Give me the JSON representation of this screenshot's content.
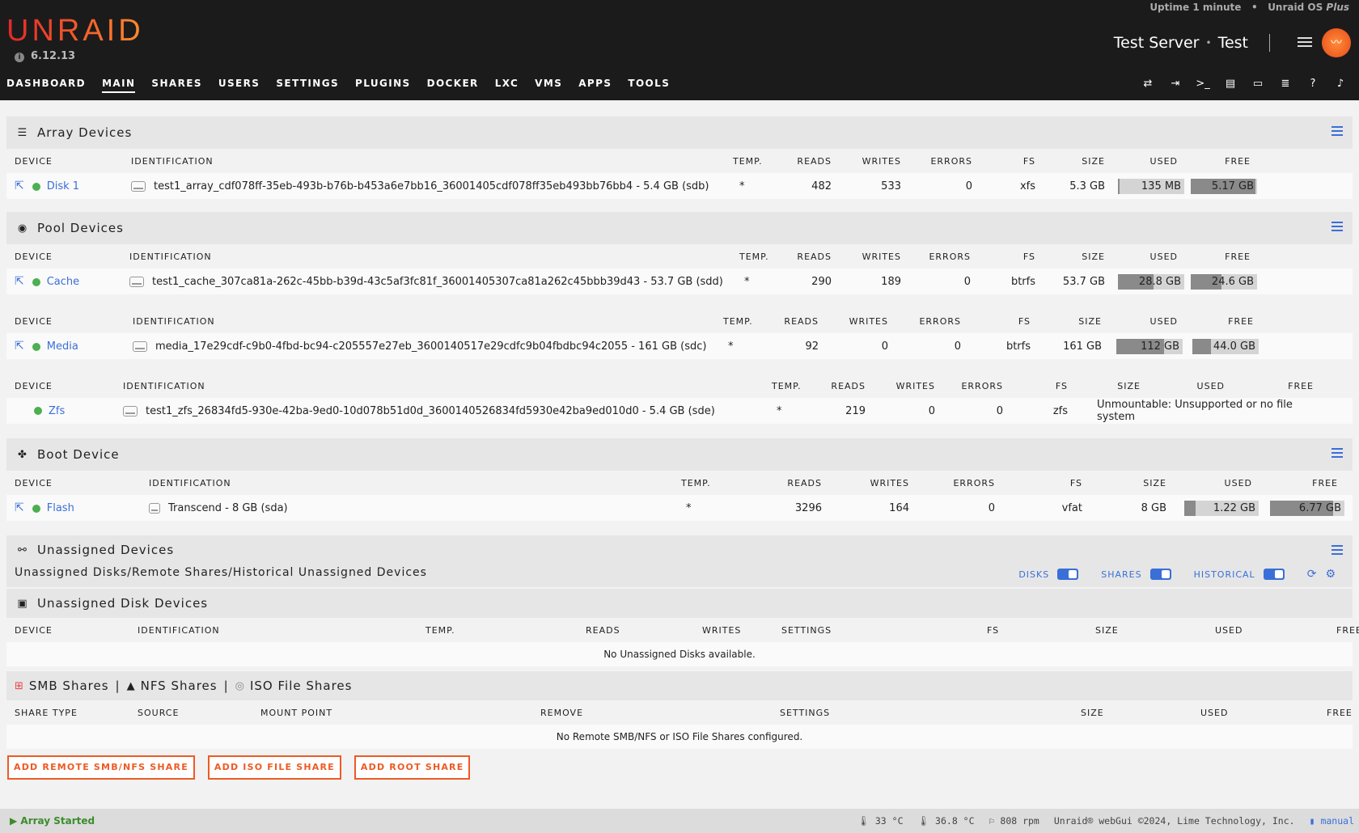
{
  "header": {
    "logo": "UNRAID",
    "version": "6.12.13",
    "uptime": "Uptime 1 minute",
    "bullet": "•",
    "os_name": "Unraid OS",
    "os_edition": "Plus",
    "server_name": "Test Server",
    "server_desc": "Test"
  },
  "nav": [
    "DASHBOARD",
    "MAIN",
    "SHARES",
    "USERS",
    "SETTINGS",
    "PLUGINS",
    "DOCKER",
    "LXC",
    "VMS",
    "APPS",
    "TOOLS"
  ],
  "nav_active": "MAIN",
  "nav_icons": [
    "sync-icon",
    "logout-icon",
    "terminal-icon",
    "feedback-icon",
    "display-icon",
    "log-icon",
    "help-icon",
    "bell-icon"
  ],
  "array": {
    "title": "Array Devices",
    "headers": [
      "DEVICE",
      "IDENTIFICATION",
      "TEMP.",
      "READS",
      "WRITES",
      "ERRORS",
      "FS",
      "SIZE",
      "USED",
      "FREE"
    ],
    "rows": [
      {
        "device": "Disk 1",
        "id": "test1_array_cdf078ff-35eb-493b-b76b-b453a6e7bb16_36001405cdf078ff35eb493bb76bb4 - 5.4 GB (sdb)",
        "temp": "*",
        "reads": "482",
        "writes": "533",
        "errors": "0",
        "fs": "xfs",
        "size": "5.3 GB",
        "used": "135 MB",
        "free": "5.17 GB",
        "used_frac": 0.03,
        "free_frac": 0.97
      }
    ]
  },
  "pool": {
    "title": "Pool Devices",
    "headers": [
      "DEVICE",
      "IDENTIFICATION",
      "TEMP.",
      "READS",
      "WRITES",
      "ERRORS",
      "FS",
      "SIZE",
      "USED",
      "FREE"
    ],
    "pools": [
      {
        "device": "Cache",
        "id": "test1_cache_307ca81a-262c-45bb-b39d-43c5af3fc81f_36001405307ca81a262c45bbb39d43 - 53.7 GB (sdd)",
        "temp": "*",
        "reads": "290",
        "writes": "189",
        "errors": "0",
        "fs": "btrfs",
        "size": "53.7 GB",
        "used": "28.8 GB",
        "free": "24.6 GB",
        "used_frac": 0.54,
        "free_frac": 0.46
      },
      {
        "device": "Media",
        "id": "media_17e29cdf-c9b0-4fbd-bc94-c205557e27eb_3600140517e29cdfc9b04fbdbc94c2055 - 161 GB (sdc)",
        "temp": "*",
        "reads": "92",
        "writes": "0",
        "errors": "0",
        "fs": "btrfs",
        "size": "161 GB",
        "used": "112 GB",
        "free": "44.0 GB",
        "used_frac": 0.72,
        "free_frac": 0.28
      },
      {
        "device": "Zfs",
        "id": "test1_zfs_26834fd5-930e-42ba-9ed0-10d078b51d0d_3600140526834fd5930e42ba9ed010d0 - 5.4 GB (sde)",
        "temp": "*",
        "reads": "219",
        "writes": "0",
        "errors": "0",
        "fs": "zfs",
        "status": "Unmountable: Unsupported or no file system"
      }
    ]
  },
  "boot": {
    "title": "Boot Device",
    "headers": [
      "DEVICE",
      "IDENTIFICATION",
      "TEMP.",
      "READS",
      "WRITES",
      "ERRORS",
      "FS",
      "SIZE",
      "USED",
      "FREE"
    ],
    "row": {
      "device": "Flash",
      "id": "Transcend - 8 GB (sda)",
      "temp": "*",
      "reads": "3296",
      "writes": "164",
      "errors": "0",
      "fs": "vfat",
      "size": "8 GB",
      "used": "1.22 GB",
      "free": "6.77 GB",
      "used_frac": 0.15,
      "free_frac": 0.85
    }
  },
  "unassigned": {
    "title": "Unassigned Devices",
    "subtitle": "Unassigned Disks/Remote Shares/Historical Unassigned Devices",
    "toggles": [
      "DISKS",
      "SHARES",
      "HISTORICAL"
    ],
    "disk_title": "Unassigned Disk Devices",
    "disk_headers": [
      "DEVICE",
      "IDENTIFICATION",
      "TEMP.",
      "READS",
      "WRITES",
      "SETTINGS",
      "FS",
      "SIZE",
      "USED",
      "FREE"
    ],
    "disk_empty": "No Unassigned Disks available.",
    "shares_title_smb": "SMB Shares",
    "shares_title_nfs": "NFS Shares",
    "shares_title_iso": "ISO File Shares",
    "share_sep": "|",
    "share_headers": [
      "SHARE TYPE",
      "SOURCE",
      "MOUNT POINT",
      "REMOVE",
      "SETTINGS",
      "SIZE",
      "USED",
      "FREE"
    ],
    "share_empty": "No Remote SMB/NFS or ISO File Shares configured.",
    "buttons": [
      "ADD REMOTE SMB/NFS SHARE",
      "ADD ISO FILE SHARE",
      "ADD ROOT SHARE"
    ]
  },
  "footer": {
    "status": "Array Started",
    "temp1": "33 °C",
    "temp2": "36.8 °C",
    "fan": "808 rpm",
    "copyright": "Unraid® webGui ©2024, Lime Technology, Inc.",
    "manual": "manual"
  }
}
